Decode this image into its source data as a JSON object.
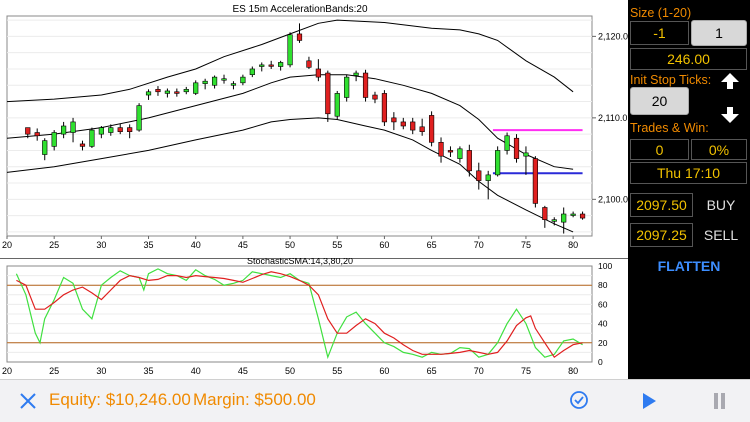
{
  "chart_data": [
    {
      "type": "candlestick",
      "title": "ES 15m AccelerationBands:20",
      "x_ticks": [
        20,
        25,
        30,
        35,
        40,
        45,
        50,
        55,
        60,
        65,
        70,
        75,
        80
      ],
      "y_ticks": [
        "2,120.0",
        "2,110.0",
        "2,100.0"
      ],
      "ylim": [
        2095.5,
        2122.5
      ],
      "candles": [
        [
          22.2,
          2108.8,
          2108.8,
          2107.5,
          2108.0
        ],
        [
          23.2,
          2108.2,
          2108.7,
          2107.2,
          2107.8
        ],
        [
          24.0,
          2105.5,
          2107.5,
          2104.8,
          2107.2
        ],
        [
          25.0,
          2106.5,
          2108.5,
          2106.0,
          2108.2
        ],
        [
          26.0,
          2108.0,
          2109.5,
          2107.5,
          2109.0
        ],
        [
          27.0,
          2108.2,
          2110.0,
          2107.0,
          2109.5
        ],
        [
          28.0,
          2106.8,
          2107.2,
          2106.0,
          2106.5
        ],
        [
          29.0,
          2106.5,
          2108.8,
          2106.3,
          2108.5
        ],
        [
          30.0,
          2108.0,
          2109.0,
          2107.5,
          2108.8
        ],
        [
          31.0,
          2108.2,
          2109.2,
          2107.8,
          2108.8
        ],
        [
          32.0,
          2108.8,
          2109.3,
          2108.0,
          2108.3
        ],
        [
          33.0,
          2108.8,
          2109.2,
          2107.5,
          2108.3
        ],
        [
          34.0,
          2108.5,
          2111.8,
          2108.3,
          2111.5
        ],
        [
          35.0,
          2112.8,
          2113.5,
          2112.2,
          2113.2
        ],
        [
          36.0,
          2113.5,
          2113.9,
          2112.7,
          2113.2
        ],
        [
          37.0,
          2113.0,
          2113.6,
          2112.5,
          2113.3
        ],
        [
          38.0,
          2113.2,
          2113.6,
          2112.6,
          2113.0
        ],
        [
          39.0,
          2113.2,
          2113.8,
          2112.9,
          2113.5
        ],
        [
          40.0,
          2113.0,
          2114.6,
          2112.8,
          2114.3
        ],
        [
          41.0,
          2114.2,
          2114.8,
          2113.5,
          2114.5
        ],
        [
          42.0,
          2114.0,
          2115.2,
          2113.6,
          2115.0
        ],
        [
          43.0,
          2114.8,
          2115.3,
          2114.2,
          2114.8
        ],
        [
          44.0,
          2114.0,
          2114.5,
          2113.5,
          2114.2
        ],
        [
          45.0,
          2114.3,
          2115.3,
          2114.0,
          2115.0
        ],
        [
          46.0,
          2115.3,
          2116.3,
          2115.0,
          2116.0
        ],
        [
          47.0,
          2116.3,
          2116.8,
          2115.7,
          2116.5
        ],
        [
          48.0,
          2116.5,
          2117.0,
          2116.0,
          2116.4
        ],
        [
          49.0,
          2116.3,
          2117.0,
          2115.8,
          2116.8
        ],
        [
          50.0,
          2116.5,
          2120.5,
          2116.2,
          2120.2
        ],
        [
          51.0,
          2120.3,
          2121.6,
          2119.2,
          2119.5
        ],
        [
          52.0,
          2117.0,
          2117.5,
          2116.0,
          2116.2
        ],
        [
          53.0,
          2116.0,
          2117.2,
          2114.5,
          2115.0
        ],
        [
          54.0,
          2115.5,
          2115.8,
          2109.5,
          2110.5
        ],
        [
          55.0,
          2110.2,
          2113.3,
          2109.8,
          2113.0
        ],
        [
          56.0,
          2112.5,
          2115.3,
          2112.0,
          2115.0
        ],
        [
          57.0,
          2115.2,
          2115.8,
          2114.5,
          2115.5
        ],
        [
          58.0,
          2115.5,
          2115.9,
          2112.0,
          2112.5
        ],
        [
          59.0,
          2112.8,
          2113.2,
          2111.8,
          2112.3
        ],
        [
          60.0,
          2113.0,
          2113.4,
          2109.0,
          2109.5
        ],
        [
          61.0,
          2110.0,
          2110.7,
          2108.5,
          2109.5
        ],
        [
          62.0,
          2109.5,
          2110.0,
          2108.6,
          2109.0
        ],
        [
          63.0,
          2109.5,
          2110.0,
          2108.0,
          2108.5
        ],
        [
          64.0,
          2108.9,
          2109.9,
          2107.8,
          2108.3
        ],
        [
          65.0,
          2110.3,
          2110.8,
          2106.5,
          2107.0
        ],
        [
          66.0,
          2107.0,
          2107.6,
          2104.5,
          2105.3
        ],
        [
          67.0,
          2106.0,
          2106.5,
          2105.2,
          2105.8
        ],
        [
          68.0,
          2105.0,
          2106.5,
          2104.5,
          2106.2
        ],
        [
          69.0,
          2106.0,
          2106.7,
          2102.8,
          2103.5
        ],
        [
          70.0,
          2103.5,
          2104.5,
          2101.2,
          2102.3
        ],
        [
          71.0,
          2102.3,
          2103.5,
          2100.0,
          2103.0
        ],
        [
          72.0,
          2103.0,
          2106.5,
          2102.8,
          2106.0
        ],
        [
          73.0,
          2106.0,
          2108.2,
          2105.5,
          2107.8
        ],
        [
          74.0,
          2107.5,
          2108.0,
          2104.5,
          2105.0
        ],
        [
          75.0,
          2105.3,
          2106.5,
          2103.0,
          2105.7
        ],
        [
          76.0,
          2105.0,
          2105.3,
          2099.0,
          2099.5
        ],
        [
          77.0,
          2099.0,
          2099.2,
          2096.5,
          2097.5
        ],
        [
          78.0,
          2097.3,
          2097.8,
          2096.8,
          2097.5
        ],
        [
          79.0,
          2097.2,
          2099.0,
          2095.8,
          2098.2
        ],
        [
          80.0,
          2098.2,
          2098.5,
          2097.8,
          2098.2
        ],
        [
          81.0,
          2098.2,
          2098.5,
          2097.5,
          2097.7
        ]
      ],
      "upper_band": [
        [
          20,
          2112.0
        ],
        [
          25,
          2112.3
        ],
        [
          30,
          2112.8
        ],
        [
          33,
          2113.5
        ],
        [
          37,
          2115.0
        ],
        [
          40,
          2116.0
        ],
        [
          43,
          2117.5
        ],
        [
          47,
          2119.0
        ],
        [
          50,
          2120.3
        ],
        [
          53,
          2121.6
        ],
        [
          55,
          2122.0
        ],
        [
          60,
          2121.7
        ],
        [
          65,
          2121.0
        ],
        [
          68,
          2120.8
        ],
        [
          70,
          2120.3
        ],
        [
          72,
          2119.5
        ],
        [
          75,
          2117.0
        ],
        [
          78,
          2115.0
        ],
        [
          80,
          2113.2
        ]
      ],
      "middle_band": [
        [
          20,
          2107.5
        ],
        [
          25,
          2108.0
        ],
        [
          30,
          2108.8
        ],
        [
          35,
          2110.0
        ],
        [
          40,
          2111.5
        ],
        [
          45,
          2113.0
        ],
        [
          48,
          2114.3
        ],
        [
          50,
          2115.0
        ],
        [
          53,
          2115.3
        ],
        [
          56,
          2115.3
        ],
        [
          59,
          2114.8
        ],
        [
          62,
          2114.0
        ],
        [
          65,
          2113.0
        ],
        [
          68,
          2111.5
        ],
        [
          70,
          2109.8
        ],
        [
          72,
          2107.5
        ],
        [
          75,
          2105.5
        ],
        [
          78,
          2104.0
        ],
        [
          80,
          2103.7
        ]
      ],
      "lower_band": [
        [
          20,
          2103.3
        ],
        [
          25,
          2104.0
        ],
        [
          30,
          2105.0
        ],
        [
          35,
          2106.0
        ],
        [
          40,
          2107.3
        ],
        [
          45,
          2108.5
        ],
        [
          48,
          2109.5
        ],
        [
          50,
          2109.8
        ],
        [
          53,
          2110.0
        ],
        [
          55,
          2109.8
        ],
        [
          58,
          2109.0
        ],
        [
          60,
          2108.5
        ],
        [
          63,
          2107.3
        ],
        [
          65,
          2106.0
        ],
        [
          68,
          2104.3
        ],
        [
          70,
          2102.2
        ],
        [
          72,
          2100.5
        ],
        [
          75,
          2098.7
        ],
        [
          78,
          2097.0
        ],
        [
          80,
          2096.0
        ]
      ],
      "h_lines": [
        {
          "y": 2108.5,
          "x0": 71.5,
          "x1": 81,
          "color": "#ff2ef2"
        },
        {
          "y": 2103.2,
          "x0": 71.5,
          "x1": 81,
          "color": "#2a2ad8"
        }
      ]
    },
    {
      "type": "line",
      "title": "StochasticSMA:14,3,80,20",
      "x_ticks": [
        20,
        25,
        30,
        35,
        40,
        45,
        50,
        55,
        60,
        65,
        70,
        75,
        80
      ],
      "y_ticks": [
        100,
        80,
        60,
        40,
        20,
        0
      ],
      "ylim": [
        0,
        100
      ],
      "ref_lines": [
        80,
        20
      ],
      "series": [
        {
          "color": "#40e040",
          "points": [
            [
              21,
              92
            ],
            [
              22,
              70
            ],
            [
              23,
              30
            ],
            [
              23.5,
              20
            ],
            [
              24,
              45
            ],
            [
              25,
              65
            ],
            [
              26,
              88
            ],
            [
              27,
              82
            ],
            [
              28,
              55
            ],
            [
              29,
              45
            ],
            [
              30,
              80
            ],
            [
              31,
              88
            ],
            [
              32,
              95
            ],
            [
              33,
              90
            ],
            [
              34,
              88
            ],
            [
              34.5,
              75
            ],
            [
              35,
              92
            ],
            [
              36,
              97
            ],
            [
              37,
              92
            ],
            [
              38,
              90
            ],
            [
              39,
              85
            ],
            [
              40,
              96
            ],
            [
              41,
              90
            ],
            [
              42,
              86
            ],
            [
              43,
              80
            ],
            [
              44,
              82
            ],
            [
              45,
              85
            ],
            [
              46,
              94
            ],
            [
              47,
              92
            ],
            [
              48,
              90
            ],
            [
              49,
              88
            ],
            [
              50,
              92
            ],
            [
              51,
              85
            ],
            [
              52,
              82
            ],
            [
              53,
              45
            ],
            [
              54,
              5
            ],
            [
              55,
              30
            ],
            [
              56,
              47
            ],
            [
              57,
              52
            ],
            [
              58,
              40
            ],
            [
              59,
              30
            ],
            [
              60,
              20
            ],
            [
              61,
              16
            ],
            [
              62,
              10
            ],
            [
              63,
              8
            ],
            [
              64,
              5
            ],
            [
              65,
              10
            ],
            [
              66,
              8
            ],
            [
              67,
              9
            ],
            [
              68,
              15
            ],
            [
              69,
              14
            ],
            [
              70,
              5
            ],
            [
              71,
              8
            ],
            [
              72,
              20
            ],
            [
              73,
              40
            ],
            [
              74,
              55
            ],
            [
              75,
              40
            ],
            [
              76,
              15
            ],
            [
              77,
              5
            ],
            [
              78,
              8
            ],
            [
              79,
              22
            ],
            [
              80,
              24
            ],
            [
              81,
              18
            ]
          ]
        },
        {
          "color": "#e02020",
          "points": [
            [
              21,
              85
            ],
            [
              22,
              80
            ],
            [
              23,
              55
            ],
            [
              24,
              55
            ],
            [
              25,
              62
            ],
            [
              26,
              70
            ],
            [
              27,
              75
            ],
            [
              28,
              78
            ],
            [
              29,
              72
            ],
            [
              30,
              65
            ],
            [
              31,
              75
            ],
            [
              32,
              85
            ],
            [
              33,
              90
            ],
            [
              34,
              88
            ],
            [
              35,
              85
            ],
            [
              36,
              86
            ],
            [
              37,
              90
            ],
            [
              38,
              90
            ],
            [
              39,
              88
            ],
            [
              40,
              90
            ],
            [
              41,
              89
            ],
            [
              42,
              88
            ],
            [
              43,
              87
            ],
            [
              44,
              85
            ],
            [
              45,
              83
            ],
            [
              46,
              87
            ],
            [
              47,
              91
            ],
            [
              48,
              94
            ],
            [
              49,
              92
            ],
            [
              50,
              89
            ],
            [
              51,
              85
            ],
            [
              52,
              80
            ],
            [
              53,
              70
            ],
            [
              54,
              45
            ],
            [
              55,
              30
            ],
            [
              56,
              30
            ],
            [
              57,
              38
            ],
            [
              58,
              45
            ],
            [
              59,
              40
            ],
            [
              60,
              30
            ],
            [
              61,
              25
            ],
            [
              62,
              18
            ],
            [
              63,
              12
            ],
            [
              64,
              8
            ],
            [
              65,
              8
            ],
            [
              66,
              8
            ],
            [
              67,
              9
            ],
            [
              68,
              10
            ],
            [
              69,
              12
            ],
            [
              70,
              10
            ],
            [
              71,
              8
            ],
            [
              72,
              10
            ],
            [
              73,
              22
            ],
            [
              74,
              38
            ],
            [
              75,
              46
            ],
            [
              75.5,
              48
            ],
            [
              76,
              35
            ],
            [
              77,
              20
            ],
            [
              78,
              5
            ],
            [
              79,
              12
            ],
            [
              80,
              18
            ],
            [
              81,
              20
            ]
          ]
        }
      ]
    }
  ],
  "panel": {
    "size_label": "Size (1-20)",
    "size_value": "-1",
    "size_button": "1",
    "price_display": "246.00",
    "init_stop_label": "Init Stop Ticks:",
    "init_stop_value": "20",
    "trades_label": "Trades & Win:",
    "trades_count": "0",
    "win_pct": "0%",
    "time": "Thu 17:10",
    "buy_price": "2097.50",
    "buy_label": "BUY",
    "sell_price": "2097.25",
    "sell_label": "SELL",
    "flatten_label": "FLATTEN"
  },
  "bottom": {
    "equity": "Equity: $10,246.00",
    "margin": "Margin: $500.00"
  },
  "colors": {
    "accent": "#f08a00",
    "price": "#f2c200",
    "flatten": "#3d8eff",
    "bull": "#30e030",
    "bear": "#e02020"
  }
}
